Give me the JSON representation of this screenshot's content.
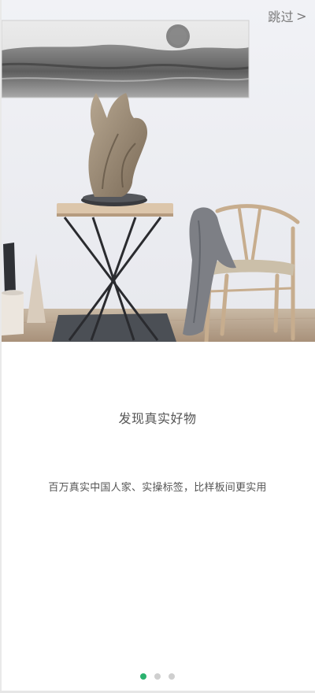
{
  "skip_button": {
    "label": "跳过",
    "arrow": ">"
  },
  "onboarding": {
    "title": "发现真实好物",
    "subtitle": "百万真实中国人家、实操标签，比样板间更实用"
  },
  "pager": {
    "count": 3,
    "active_index": 0,
    "active_color": "#2bb26f",
    "inactive_color": "#cfcfcf"
  }
}
